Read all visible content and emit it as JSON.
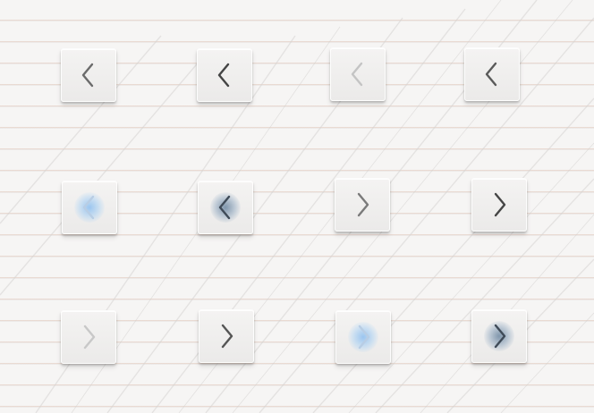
{
  "buttons": [
    {
      "id": "prev-1",
      "direction": "left",
      "state": "normal",
      "icon": "chevron-left-icon",
      "color": "#6b6b6b",
      "glow": "none"
    },
    {
      "id": "prev-2",
      "direction": "left",
      "state": "hover",
      "icon": "chevron-left-icon",
      "color": "#444444",
      "glow": "none"
    },
    {
      "id": "prev-3",
      "direction": "left",
      "state": "disabled",
      "icon": "chevron-left-icon",
      "color": "#c4c4c4",
      "glow": "none"
    },
    {
      "id": "prev-4",
      "direction": "left",
      "state": "normal",
      "icon": "chevron-left-icon",
      "color": "#5a5a5a",
      "glow": "none"
    },
    {
      "id": "prev-5",
      "direction": "left",
      "state": "focus",
      "icon": "chevron-left-icon",
      "color": "#b8cde4",
      "glow": "blue"
    },
    {
      "id": "prev-6",
      "direction": "left",
      "state": "pressed",
      "icon": "chevron-left-icon",
      "color": "#3f4b58",
      "glow": "slate"
    },
    {
      "id": "next-1",
      "direction": "right",
      "state": "normal",
      "icon": "chevron-right-icon",
      "color": "#7a7a7a",
      "glow": "none"
    },
    {
      "id": "next-2",
      "direction": "right",
      "state": "hover",
      "icon": "chevron-right-icon",
      "color": "#454545",
      "glow": "none"
    },
    {
      "id": "next-3",
      "direction": "right",
      "state": "disabled",
      "icon": "chevron-right-icon",
      "color": "#c8c8c8",
      "glow": "none"
    },
    {
      "id": "next-4",
      "direction": "right",
      "state": "normal",
      "icon": "chevron-right-icon",
      "color": "#555555",
      "glow": "none"
    },
    {
      "id": "next-5",
      "direction": "right",
      "state": "focus",
      "icon": "chevron-right-icon",
      "color": "#b8cde4",
      "glow": "blue"
    },
    {
      "id": "next-6",
      "direction": "right",
      "state": "pressed",
      "icon": "chevron-right-icon",
      "color": "#3f4b58",
      "glow": "slate"
    }
  ],
  "colors": {
    "paper": "#f6f5f4",
    "rule_line": "#dabaaa",
    "button_face": "#efeeed",
    "focus_glow": "#8cbef0",
    "pressed_glow": "#5a7896"
  }
}
